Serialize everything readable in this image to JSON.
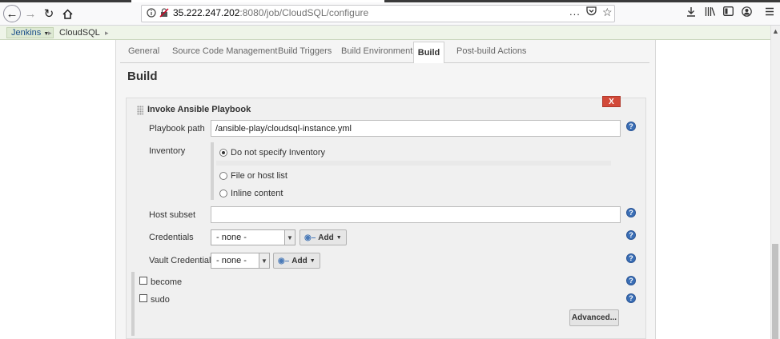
{
  "browser": {
    "url_host": "35.222.247.202",
    "url_rest": ":8080/job/CloudSQL/configure",
    "more_icon": "...",
    "icons": [
      "back-icon",
      "forward-icon",
      "reload-icon",
      "home-icon",
      "info-icon",
      "insecure-icon",
      "pocket-icon",
      "bookmark-star-icon",
      "download-icon",
      "library-icon",
      "sidebar-icon",
      "account-icon",
      "menu-icon"
    ]
  },
  "breadcrumb": {
    "root": "Jenkins",
    "job": "CloudSQL"
  },
  "tabs": [
    {
      "label": "General"
    },
    {
      "label": "Source Code Management"
    },
    {
      "label": "Build Triggers"
    },
    {
      "label": "Build Environment"
    },
    {
      "label": "Build",
      "active": true
    },
    {
      "label": "Post-build Actions"
    }
  ],
  "section_title": "Build",
  "build_step": {
    "title": "Invoke Ansible Playbook",
    "delete_label": "X",
    "playbook_path": {
      "label": "Playbook path",
      "value": "/ansible-play/cloudsql-instance.yml"
    },
    "inventory": {
      "label": "Inventory",
      "options": [
        {
          "label": "Do not specify Inventory",
          "checked": true
        },
        {
          "label": "File or host list",
          "checked": false
        },
        {
          "label": "Inline content",
          "checked": false
        }
      ]
    },
    "host_subset": {
      "label": "Host subset",
      "value": ""
    },
    "credentials": {
      "label": "Credentials",
      "selected": "- none -",
      "add_label": "Add"
    },
    "vault_credentials": {
      "label": "Vault Credentials",
      "selected": "- none -",
      "add_label": "Add"
    },
    "become": {
      "label": "become",
      "checked": false
    },
    "sudo": {
      "label": "sudo",
      "checked": false
    },
    "advanced_label": "Advanced...",
    "help_glyph": "?"
  },
  "colors": {
    "delete_button": "#d24939",
    "help_icon": "#3b6fb6",
    "breadcrumb_bg": "#eef4e8"
  }
}
